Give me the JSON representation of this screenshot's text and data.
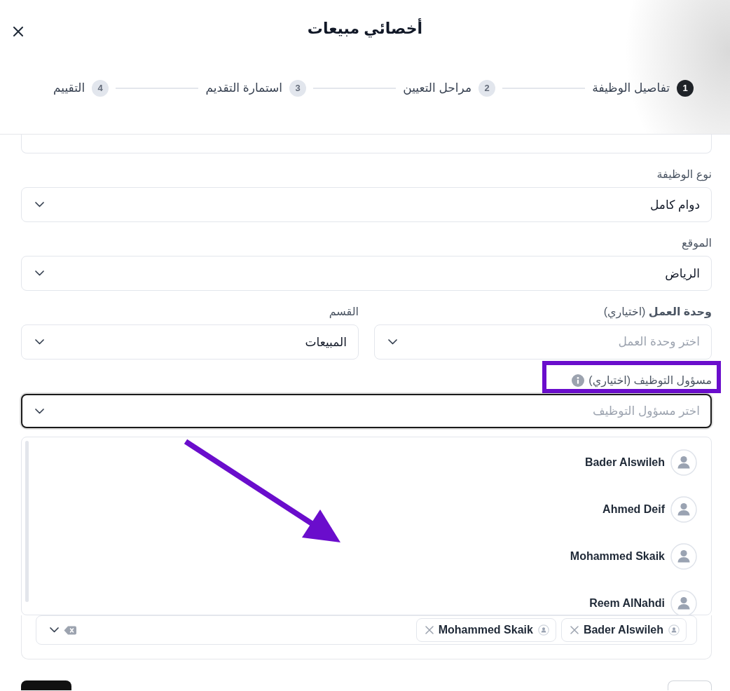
{
  "dialog": {
    "title": "أخصائي مبيعات"
  },
  "steps": [
    {
      "number": "1",
      "label": "تفاصيل الوظيفة",
      "selected": true
    },
    {
      "number": "2",
      "label": "مراحل التعيين",
      "selected": false
    },
    {
      "number": "3",
      "label": "استمارة التقديم",
      "selected": false
    },
    {
      "number": "4",
      "label": "التقييم",
      "selected": false
    }
  ],
  "form_rows": [
    [
      {
        "kind": "input"
      }
    ],
    [
      {
        "kind": "select",
        "label": "نوع الوظيفة",
        "value": "دوام كامل"
      }
    ],
    [
      {
        "kind": "select",
        "label": "الموقع",
        "value": "الرياض"
      }
    ],
    [
      {
        "kind": "select",
        "label": "**وحدة العمل** (اختياري)",
        "placeholder": "اختر وحدة العمل"
      },
      {
        "kind": "select",
        "label": "القسم",
        "value": "المبيعات"
      }
    ]
  ],
  "recruiter": {
    "label": "مسؤول التوظيف (اختياري)",
    "info": true,
    "placeholder": "اختر مسؤول التوظيف",
    "focused": true,
    "expanded": true,
    "options": [
      {
        "name": "Bader Alswileh"
      },
      {
        "name": "Ahmed Deif"
      },
      {
        "name": "Mohammed Skaik"
      },
      {
        "name": "Reem AlNahdi"
      }
    ],
    "chosen": [
      {
        "name": "Bader Alswileh"
      },
      {
        "name": "Mohammed Skaik"
      }
    ]
  },
  "footer_buttons": [
    {
      "kind": "outline"
    },
    {
      "kind": "primary"
    }
  ]
}
